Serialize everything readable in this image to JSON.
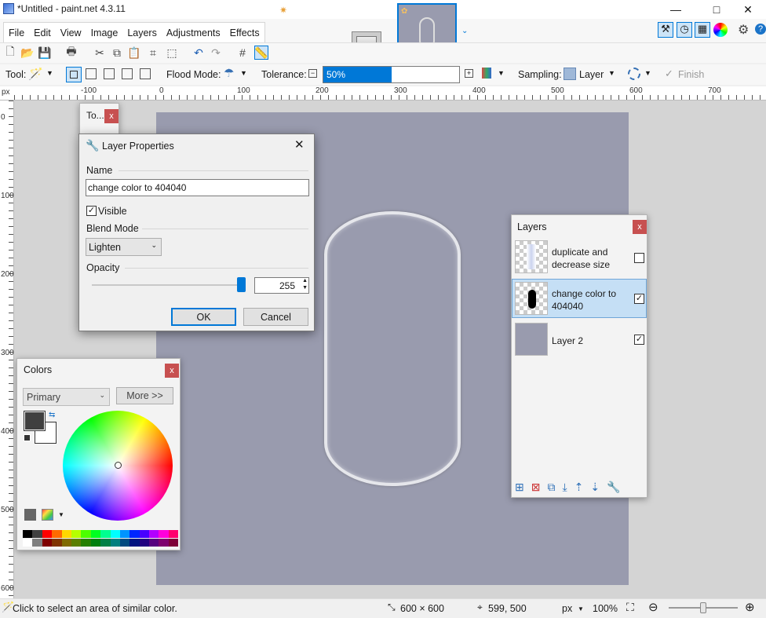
{
  "window": {
    "title": "*Untitled - paint.net 4.3.11",
    "min": "—",
    "max": "□",
    "close": "✕"
  },
  "menu": [
    "File",
    "Edit",
    "View",
    "Image",
    "Layers",
    "Adjustments",
    "Effects"
  ],
  "toolbar2": {
    "tool_label": "Tool:",
    "flood_label": "Flood Mode:",
    "tolerance_label": "Tolerance:",
    "tolerance_value": "50%",
    "tolerance_fraction": 0.5,
    "sampling_label": "Sampling:",
    "sampling_value": "Layer",
    "finish_label": "Finish"
  },
  "ruler": {
    "unit": "px",
    "h_ticks": [
      "-100",
      "0",
      "100",
      "200",
      "300",
      "400",
      "500",
      "600",
      "700"
    ],
    "v_ticks": [
      "0",
      "100",
      "200",
      "300",
      "400",
      "500",
      "600"
    ]
  },
  "tools_panel": {
    "title": "To...",
    "close": "x"
  },
  "dialog": {
    "title": "Layer Properties",
    "close": "✕",
    "name_label": "Name",
    "name_value": "change color to 404040",
    "visible_label": "Visible",
    "visible_check": "✓",
    "blend_label": "Blend Mode",
    "blend_value": "Lighten",
    "opacity_label": "Opacity",
    "opacity_value": "255",
    "ok_label": "OK",
    "cancel_label": "Cancel"
  },
  "layers": {
    "title": "Layers",
    "close": "x",
    "items": [
      {
        "name_line1": "duplicate and",
        "name_line2": "decrease size",
        "check": ""
      },
      {
        "name_line1": "change color to",
        "name_line2": "404040",
        "check": "✓"
      },
      {
        "name_line1": "Layer 2",
        "name_line2": "",
        "check": "✓"
      }
    ]
  },
  "colors": {
    "title": "Colors",
    "close": "x",
    "mode": "Primary",
    "more_label": "More >>",
    "primary_color": "#404040",
    "secondary_color": "#ffffff",
    "palette_top": [
      "#000000",
      "#404040",
      "#ff0000",
      "#ff6a00",
      "#ffd800",
      "#b6ff00",
      "#4cff00",
      "#00ff21",
      "#00ff90",
      "#00ffff",
      "#0094ff",
      "#0026ff",
      "#4800ff",
      "#b200ff",
      "#ff00dc",
      "#ff006e"
    ],
    "palette_bottom": [
      "#ffffff",
      "#808080",
      "#7f0000",
      "#7f3300",
      "#7f6a00",
      "#5b7f00",
      "#267f00",
      "#007f0e",
      "#007f46",
      "#007f7f",
      "#004a7f",
      "#00137f",
      "#21007f",
      "#57007f",
      "#7f006e",
      "#7f0037"
    ]
  },
  "status": {
    "hint": "Click to select an area of similar color.",
    "size": "600 × 600",
    "pos": "599, 500",
    "unit": "px",
    "zoom": "100%"
  },
  "colors_accent": {
    "selection": "#0078d7",
    "layer_selected": "#c5dff5",
    "canvas": "#999bae"
  }
}
